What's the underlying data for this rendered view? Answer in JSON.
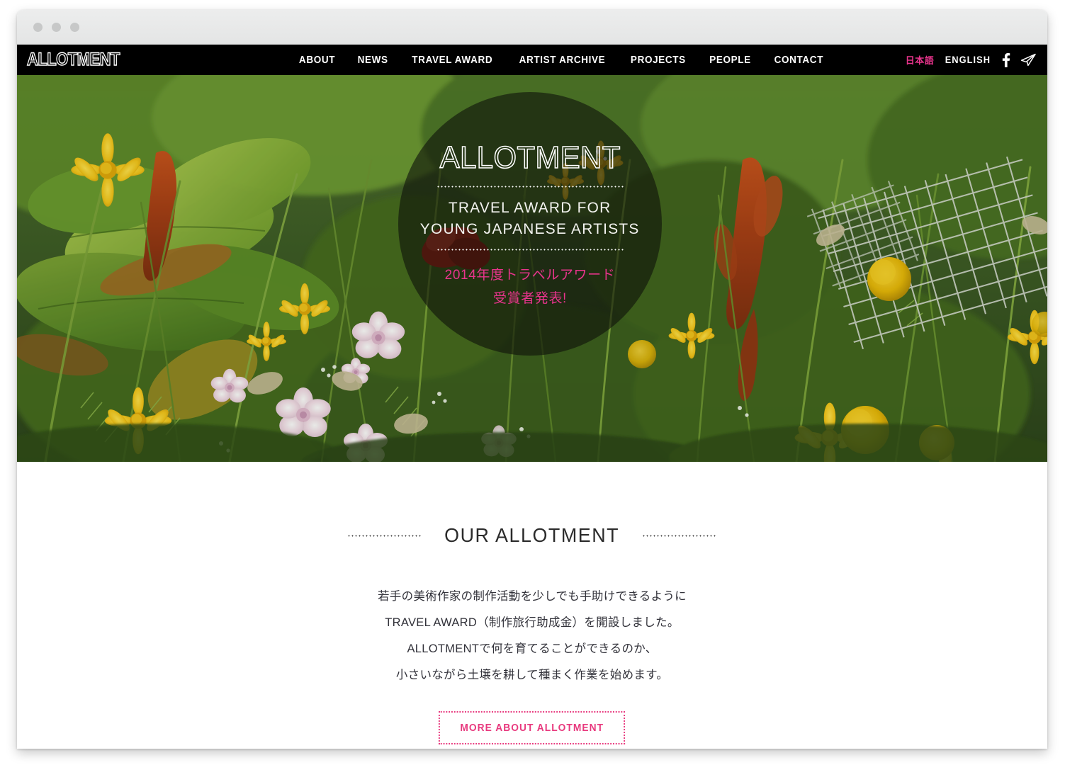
{
  "window": {
    "traffic_lights": [
      "close",
      "minimize",
      "maximize"
    ]
  },
  "nav": {
    "logo": "ALLOTMENT",
    "menu": [
      {
        "label": "ABOUT"
      },
      {
        "label": "NEWS"
      },
      {
        "label": "TRAVEL AWARD"
      },
      {
        "label": "ARTIST ARCHIVE"
      },
      {
        "label": "PROJECTS"
      },
      {
        "label": "PEOPLE"
      },
      {
        "label": "CONTACT"
      }
    ],
    "lang_ja": "日本語",
    "lang_en": "ENGLISH",
    "social": [
      {
        "name": "facebook-icon",
        "glyph": "f"
      },
      {
        "name": "send-icon",
        "glyph": "paper-plane"
      }
    ]
  },
  "hero": {
    "title": "ALLOTMENT",
    "subtitle_line1": "TRAVEL AWARD FOR",
    "subtitle_line2": "YOUNG JAPANESE ARTISTS",
    "announcement_line1": "2014年度トラベルアワード",
    "announcement_line2": "受賞者発表!",
    "image_description": "garden allotment with yellow daisies, pink cornflowers, red amaranth and wire mesh fencing"
  },
  "section": {
    "title": "OUR ALLOTMENT",
    "body": [
      "若手の美術作家の制作活動を少しでも手助けできるように",
      "TRAVEL AWARD（制作旅行助成金）を開設しました。",
      "ALLOTMENTで何を育てることができるのか、",
      "小さいながら土壌を耕して種まく作業を始めます。"
    ],
    "cta_label": "MORE ABOUT ALLOTMENT"
  },
  "colors": {
    "accent_pink": "#e8348c",
    "cta_pink": "#e8397e",
    "nav_background": "#000000",
    "text_dark": "#2b2b2b"
  }
}
